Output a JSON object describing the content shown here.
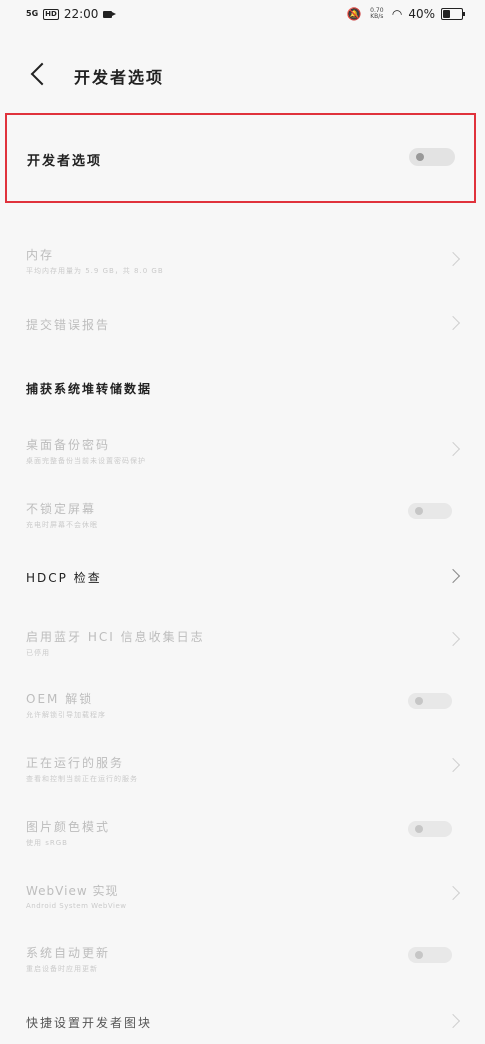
{
  "status_bar": {
    "signal": "5G",
    "hd": "HD",
    "time": "22:00",
    "net_speed": "0.70 KB/s",
    "battery": "40%",
    "battery_level": 0.4
  },
  "header": {
    "title": "开发者选项"
  },
  "master": {
    "label": "开发者选项",
    "enabled": false
  },
  "rows": [
    {
      "label": "内存",
      "sub": "平均内存用量为 5.9 GB，共 8.0 GB",
      "control": "chevron"
    },
    {
      "label": "提交错误报告",
      "sub": "",
      "control": "chevron"
    },
    {
      "label": "捕获系统堆转储数据",
      "sub": "",
      "control": "none"
    },
    {
      "label": "桌面备份密码",
      "sub": "桌面完整备份当前未设置密码保护",
      "control": "chevron"
    },
    {
      "label": "不锁定屏幕",
      "sub": "充电时屏幕不会休眠",
      "control": "toggle"
    },
    {
      "label": "HDCP 检查",
      "sub": "",
      "control": "chevron"
    },
    {
      "label": "启用蓝牙 HCI 信息收集日志",
      "sub": "已停用",
      "control": "chevron"
    },
    {
      "label": "OEM 解锁",
      "sub": "允许解锁引导加载程序",
      "control": "toggle"
    },
    {
      "label": "正在运行的服务",
      "sub": "查看和控制当前正在运行的服务",
      "control": "chevron"
    },
    {
      "label": "图片颜色模式",
      "sub": "使用 sRGB",
      "control": "toggle"
    },
    {
      "label": "WebView 实现",
      "sub": "Android System WebView",
      "control": "chevron"
    },
    {
      "label": "系统自动更新",
      "sub": "重启设备时应用更新",
      "control": "toggle"
    },
    {
      "label": "快捷设置开发者图块",
      "sub": "",
      "control": "chevron"
    }
  ]
}
